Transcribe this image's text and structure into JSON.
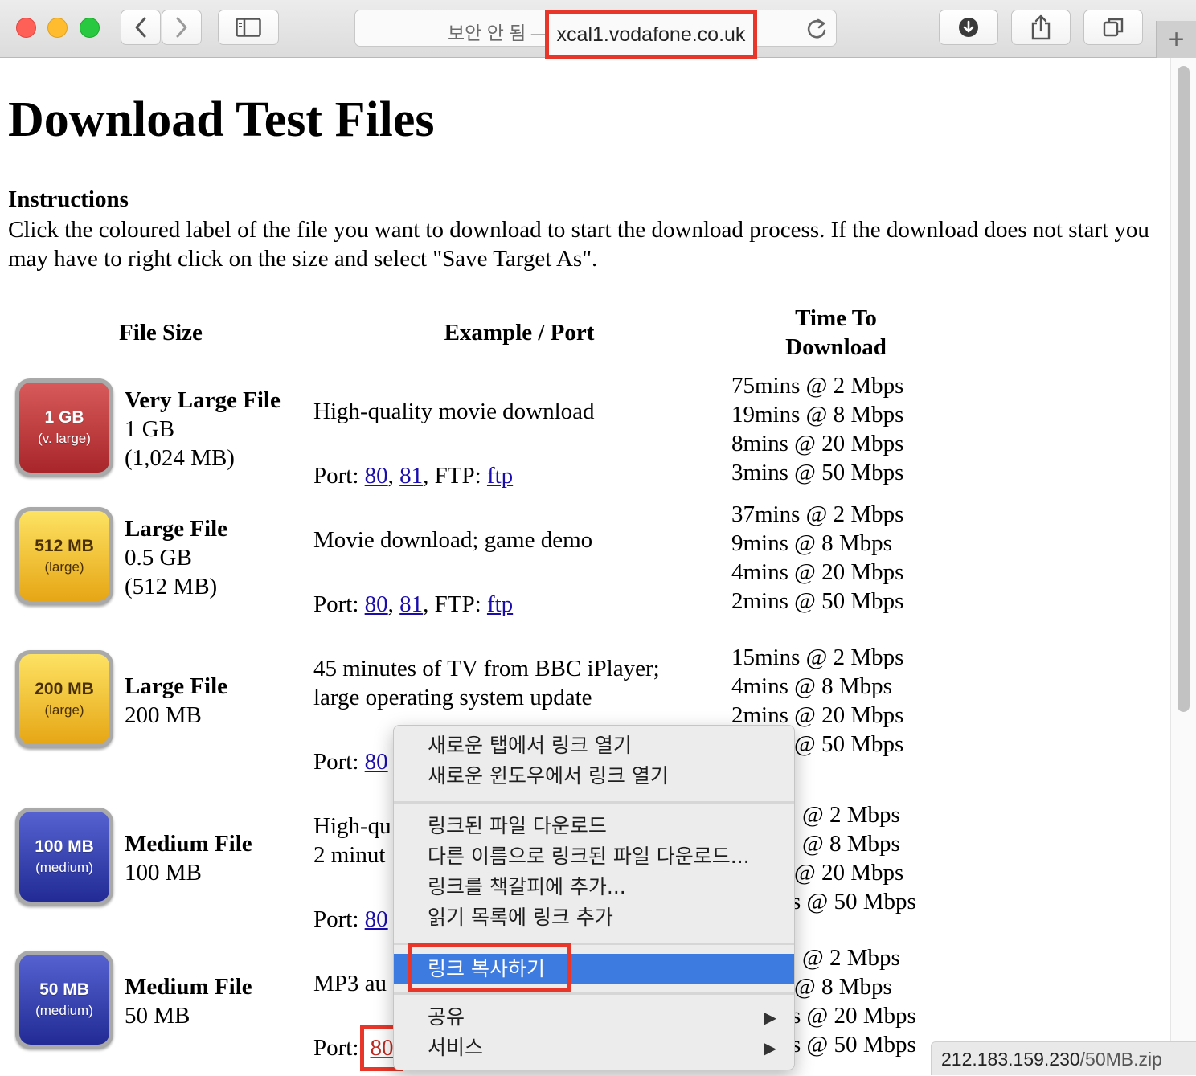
{
  "toolbar": {
    "address": {
      "security_label": "보안 안 됨 —",
      "host": "xcal1.vodafone.co.uk"
    },
    "new_tab_label": "+"
  },
  "page": {
    "title": "Download Test Files",
    "instructions_heading": "Instructions",
    "instructions_text": "Click the coloured label of the file you want to download to start the download process. If the download does not start you may have to right click on the size and select \"Save Target As\".",
    "headers": {
      "file_size": "File Size",
      "example_port": "Example / Port",
      "time_line1": "Time To",
      "time_line2": "Download"
    },
    "rows": [
      {
        "badge_size": "1 GB",
        "badge_tag": "(v. large)",
        "name": "Very Large File",
        "size": "1 GB",
        "size_detail": "(1,024 MB)",
        "example_line1": "High-quality movie download",
        "example_line2": "",
        "port_label": "Port:",
        "port1": "80",
        "comma": ",",
        "port2": "81",
        "ftp_label": ", FTP:",
        "ftp": "ftp",
        "times": [
          "75mins @ 2 Mbps",
          "19mins @ 8 Mbps",
          "8mins @ 20 Mbps",
          "3mins @ 50 Mbps"
        ]
      },
      {
        "badge_size": "512 MB",
        "badge_tag": "(large)",
        "name": "Large File",
        "size": "0.5 GB",
        "size_detail": "(512 MB)",
        "example_line1": "Movie download; game demo",
        "example_line2": "",
        "port_label": "Port:",
        "port1": "80",
        "comma": ",",
        "port2": "81",
        "ftp_label": ", FTP:",
        "ftp": "ftp",
        "times": [
          "37mins @ 2 Mbps",
          "9mins @ 8 Mbps",
          "4mins @ 20 Mbps",
          "2mins @ 50 Mbps"
        ]
      },
      {
        "badge_size": "200 MB",
        "badge_tag": "(large)",
        "name": "Large File",
        "size": "200 MB",
        "size_detail": "",
        "example_line1": "45 minutes of TV from BBC iPlayer;",
        "example_line2": "large operating system update",
        "port_label": "Port:",
        "port1": "80",
        "times": [
          "15mins @ 2 Mbps",
          "4mins @ 8 Mbps",
          "2mins @ 20 Mbps",
          "@ 50 Mbps"
        ]
      },
      {
        "badge_size": "100 MB",
        "badge_tag": "(medium)",
        "name": "Medium File",
        "size": "100 MB",
        "size_detail": "",
        "example_line1": "High-qu",
        "example_line2": "2 minut",
        "port_label": "Port:",
        "port1": "80",
        "times": [
          "@ 2 Mbps",
          "@ 8 Mbps",
          "@ 20 Mbps",
          "s @ 50 Mbps"
        ]
      },
      {
        "badge_size": "50 MB",
        "badge_tag": "(medium)",
        "name": "Medium File",
        "size": "50 MB",
        "size_detail": "",
        "example_line1": "MP3 au",
        "example_line2": "",
        "port_label": "Port:",
        "port1": "80",
        "times": [
          "@ 2 Mbps",
          "@ 8 Mbps",
          "s @ 20 Mbps",
          "s @ 50 Mbps"
        ]
      }
    ]
  },
  "context_menu": {
    "open_new_tab": "새로운 탭에서 링크 열기",
    "open_new_window": "새로운 윈도우에서 링크 열기",
    "download_linked_file": "링크된 파일 다운로드",
    "download_linked_file_as": "다른 이름으로 링크된 파일 다운로드...",
    "add_bookmark": "링크를 책갈피에 추가...",
    "add_reading_list": "읽기 목록에 링크 추가",
    "copy_link": "링크 복사하기",
    "share": "공유",
    "services": "서비스",
    "submenu_arrow": "▶"
  },
  "status_bar": {
    "host": "212.183.159.230",
    "path": "/50MB.zip"
  },
  "colors": {
    "highlight_box": "#e8372a",
    "menu_selection": "#3d7be0",
    "link": "#1a0dab",
    "badge_red": "#a8262a",
    "badge_yellow": "#e6a615",
    "badge_blue": "#222b95"
  }
}
